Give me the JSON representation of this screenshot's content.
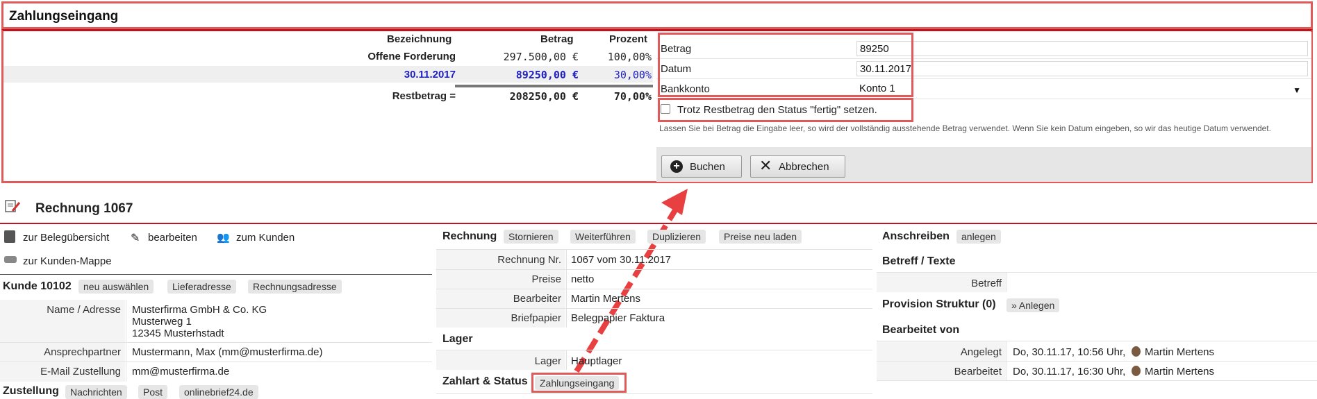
{
  "top": {
    "title": "Zahlungseingang",
    "columns": {
      "bezeichnung": "Bezeichnung",
      "betrag": "Betrag",
      "prozent": "Prozent"
    },
    "rows": [
      {
        "bezeichnung": "Offene Forderung",
        "betrag": "297.500,00 €",
        "prozent": "100,00%"
      },
      {
        "bezeichnung": "30.11.2017",
        "betrag": "89250,00 €",
        "prozent": "30,00%"
      }
    ],
    "rest": {
      "bezeichnung": "Restbetrag =",
      "betrag": "208250,00 €",
      "prozent": "70,00%"
    },
    "form": {
      "betrag_label": "Betrag",
      "betrag_value": "89250",
      "datum_label": "Datum",
      "datum_value": "30.11.2017",
      "bankkonto_label": "Bankkonto",
      "bankkonto_value": "Konto 1",
      "checkbox_label": "Trotz Restbetrag den Status \"fertig\" setzen.",
      "hint": "Lassen Sie bei Betrag die Eingabe leer, so wird der vollständig ausstehende Betrag verwendet. Wenn Sie kein Datum eingeben, so wir das heutige Datum verwendet.",
      "buchen": "Buchen",
      "abbrechen": "Abbrechen"
    }
  },
  "invoice": {
    "title": "Rechnung 1067",
    "links": {
      "belege": "zur Belegübersicht",
      "edit": "bearbeiten",
      "kunde": "zum Kunden",
      "mappe": "zur Kunden-Mappe"
    },
    "kunde": {
      "title": "Kunde 10102",
      "tags": [
        "neu auswählen",
        "Lieferadresse",
        "Rechnungsadresse"
      ],
      "name_label": "Name / Adresse",
      "address": [
        "Musterfirma GmbH & Co. KG",
        "Musterweg 1",
        "12345 Musterhstadt"
      ],
      "ansprech_label": "Ansprechpartner",
      "ansprech_value": "Mustermann, Max (mm@musterfirma.de)",
      "email_label": "E-Mail Zustellung",
      "email_value": "mm@musterfirma.de"
    },
    "zustellung": {
      "title": "Zustellung",
      "tags": [
        "Nachrichten",
        "Post",
        "onlinebrief24.de"
      ]
    },
    "rechnung": {
      "title": "Rechnung",
      "tags": [
        "Stornieren",
        "Weiterführen",
        "Duplizieren",
        "Preise neu laden"
      ],
      "nr_label": "Rechnung Nr.",
      "nr_value": "1067 vom 30.11.2017",
      "preise_label": "Preise",
      "preise_value": "netto",
      "bearbeiter_label": "Bearbeiter",
      "bearbeiter_value": "Martin Mertens",
      "brief_label": "Briefpapier",
      "brief_value": "Belegpapier Faktura"
    },
    "lager": {
      "title": "Lager",
      "label": "Lager",
      "value": "Hauptlager"
    },
    "zahlart": {
      "title": "Zahlart & Status",
      "button": "Zahlungseingang"
    },
    "anschreiben": {
      "title": "Anschreiben",
      "tag": "anlegen"
    },
    "betreff": {
      "title": "Betreff / Texte",
      "label": "Betreff"
    },
    "provision": {
      "title": "Provision Struktur (0)",
      "tag": "» Anlegen"
    },
    "bearbeitet": {
      "title": "Bearbeitet von",
      "angelegt_label": "Angelegt",
      "angelegt_value": "Do, 30.11.17, 10:56 Uhr,",
      "angelegt_user": "Martin Mertens",
      "bearbeitet_label": "Bearbeitet",
      "bearbeitet_value": "Do, 30.11.17, 16:30 Uhr,",
      "bearbeitet_user": "Martin Mertens"
    }
  },
  "colors": {
    "highlight_red": "#e05a5a",
    "header_red": "#c0141c",
    "value_blue": "#2020c0"
  }
}
